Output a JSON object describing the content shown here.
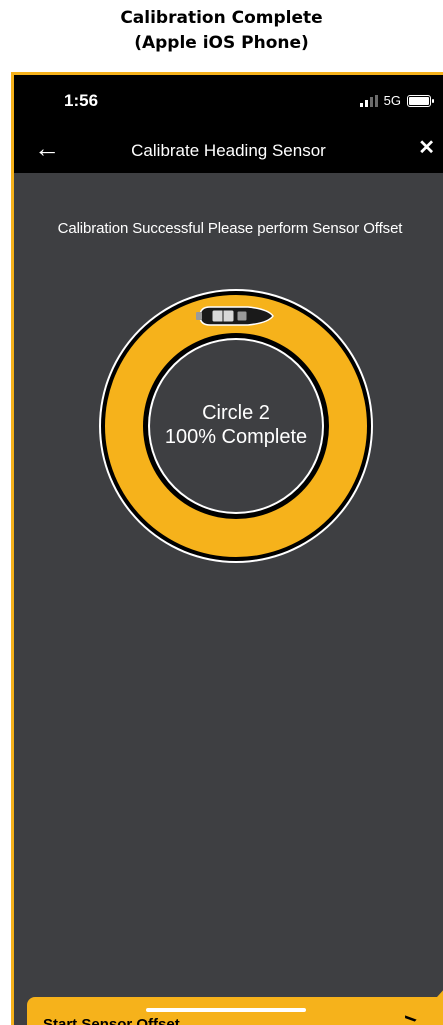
{
  "caption": {
    "line1": "Calibration Complete",
    "line2": "(Apple iOS Phone)"
  },
  "status_bar": {
    "time": "1:56",
    "network": "5G"
  },
  "nav": {
    "title": "Calibrate Heading Sensor",
    "back_icon": "arrow-left-icon",
    "close_icon": "close-icon"
  },
  "message": "Calibration Successful Please perform Sensor Offset",
  "progress": {
    "circle_label": "Circle 2",
    "percent_label": "100% Complete",
    "fraction_complete": 1.0
  },
  "action": {
    "label": "Start Sensor Offset",
    "chevron": ">"
  },
  "colors": {
    "accent": "#f6b21b",
    "background": "#3e3f42",
    "bar": "#000000"
  }
}
